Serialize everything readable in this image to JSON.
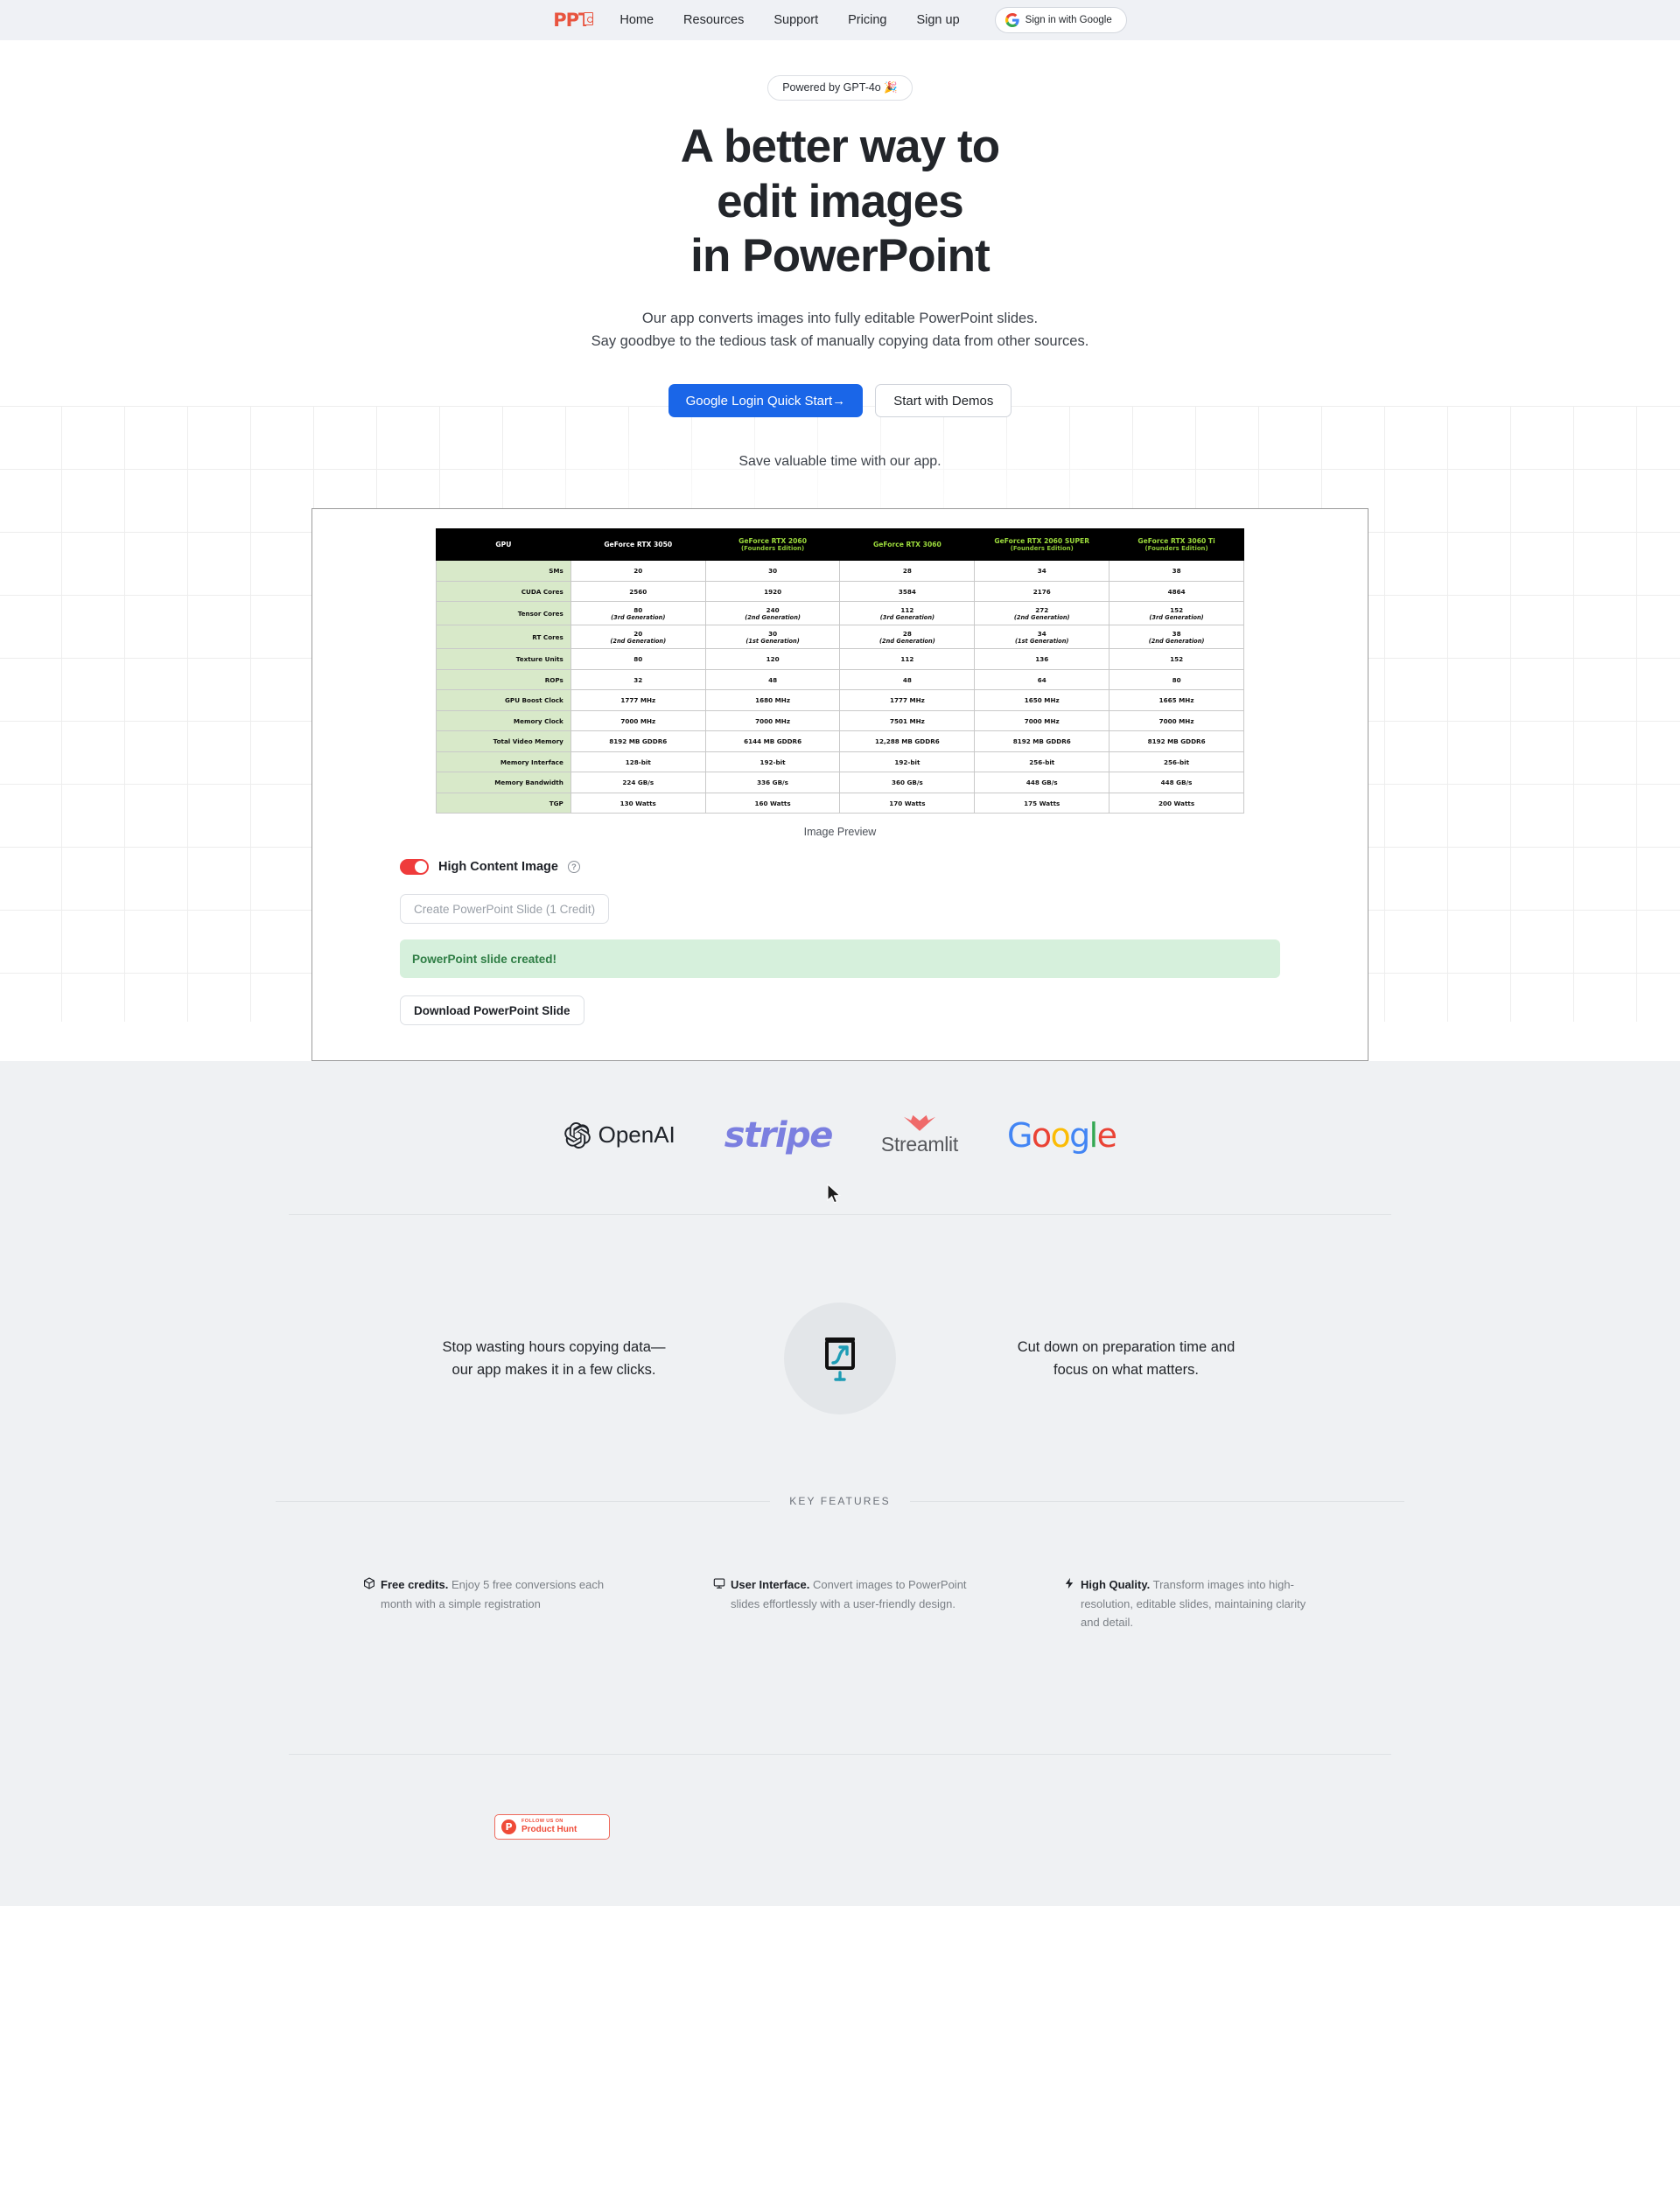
{
  "nav": {
    "logo": "PPT",
    "links": [
      "Home",
      "Resources",
      "Support",
      "Pricing",
      "Sign up"
    ],
    "google_button": "Sign in with Google"
  },
  "hero": {
    "pill": "Powered by GPT-4o 🎉",
    "title_lines": [
      "A better way to",
      "edit images",
      "in PowerPoint"
    ],
    "subtitle_lines": [
      "Our app converts images into fully editable PowerPoint slides.",
      "Say goodbye to the tedious task of manually copying data from other sources."
    ],
    "primary_cta": "Google Login Quick Start→",
    "secondary_cta": "Start with Demos",
    "tagline": "Save valuable time with our app."
  },
  "app": {
    "preview_label": "Image Preview",
    "toggle_label": "High Content Image",
    "toggle_on": true,
    "toggle_color": "#ef3b3b",
    "help_icon": "?",
    "create_button": "Create PowerPoint Slide (1 Credit)",
    "status_message": "PowerPoint slide created!",
    "status_color": "#2e7d44",
    "download_button": "Download PowerPoint Slide"
  },
  "chart_data": {
    "type": "table",
    "title": "GPU Comparison",
    "columns": [
      {
        "name": "GPU",
        "sub": "",
        "accent": false
      },
      {
        "name": "GeForce RTX 3050",
        "sub": "",
        "accent": false
      },
      {
        "name": "GeForce RTX 2060",
        "sub": "(Founders Edition)",
        "accent": true
      },
      {
        "name": "GeForce RTX 3060",
        "sub": "",
        "accent": true
      },
      {
        "name": "GeForce RTX 2060 SUPER",
        "sub": "(Founders Edition)",
        "accent": true
      },
      {
        "name": "GeForce RTX 3060 Ti",
        "sub": "(Founders Edition)",
        "accent": true
      }
    ],
    "rows": [
      {
        "label": "SMs",
        "values": [
          "20",
          "30",
          "28",
          "34",
          "38"
        ],
        "subs": [
          "",
          "",
          "",
          "",
          ""
        ]
      },
      {
        "label": "CUDA Cores",
        "values": [
          "2560",
          "1920",
          "3584",
          "2176",
          "4864"
        ],
        "subs": [
          "",
          "",
          "",
          "",
          ""
        ]
      },
      {
        "label": "Tensor Cores",
        "values": [
          "80",
          "240",
          "112",
          "272",
          "152"
        ],
        "subs": [
          "(3rd Generation)",
          "(2nd Generation)",
          "(3rd Generation)",
          "(2nd Generation)",
          "(3rd Generation)"
        ]
      },
      {
        "label": "RT Cores",
        "values": [
          "20",
          "30",
          "28",
          "34",
          "38"
        ],
        "subs": [
          "(2nd Generation)",
          "(1st Generation)",
          "(2nd Generation)",
          "(1st Generation)",
          "(2nd Generation)"
        ]
      },
      {
        "label": "Texture Units",
        "values": [
          "80",
          "120",
          "112",
          "136",
          "152"
        ],
        "subs": [
          "",
          "",
          "",
          "",
          ""
        ]
      },
      {
        "label": "ROPs",
        "values": [
          "32",
          "48",
          "48",
          "64",
          "80"
        ],
        "subs": [
          "",
          "",
          "",
          "",
          ""
        ]
      },
      {
        "label": "GPU Boost Clock",
        "values": [
          "1777 MHz",
          "1680 MHz",
          "1777 MHz",
          "1650 MHz",
          "1665 MHz"
        ],
        "subs": [
          "",
          "",
          "",
          "",
          ""
        ]
      },
      {
        "label": "Memory Clock",
        "values": [
          "7000 MHz",
          "7000 MHz",
          "7501 MHz",
          "7000 MHz",
          "7000 MHz"
        ],
        "subs": [
          "",
          "",
          "",
          "",
          ""
        ]
      },
      {
        "label": "Total Video Memory",
        "values": [
          "8192 MB GDDR6",
          "6144 MB GDDR6",
          "12,288 MB GDDR6",
          "8192 MB GDDR6",
          "8192 MB GDDR6"
        ],
        "subs": [
          "",
          "",
          "",
          "",
          ""
        ]
      },
      {
        "label": "Memory Interface",
        "values": [
          "128-bit",
          "192-bit",
          "192-bit",
          "256-bit",
          "256-bit"
        ],
        "subs": [
          "",
          "",
          "",
          "",
          ""
        ]
      },
      {
        "label": "Memory Bandwidth",
        "values": [
          "224 GB/s",
          "336 GB/s",
          "360 GB/s",
          "448 GB/s",
          "448 GB/s"
        ],
        "subs": [
          "",
          "",
          "",
          "",
          ""
        ]
      },
      {
        "label": "TGP",
        "values": [
          "130 Watts",
          "160 Watts",
          "170 Watts",
          "175 Watts",
          "200 Watts"
        ],
        "subs": [
          "",
          "",
          "",
          "",
          ""
        ]
      }
    ],
    "header_bg": "#000000",
    "header_accent_color": "#9cdb3c",
    "rowlabel_bg": "#d8e9c9"
  },
  "brands": [
    {
      "name": "OpenAI",
      "icon": "openai-icon"
    },
    {
      "name": "stripe",
      "icon": "stripe-wordmark"
    },
    {
      "name": "Streamlit",
      "icon": "streamlit-icon"
    },
    {
      "name": "Google",
      "icon": "google-wordmark"
    }
  ],
  "value_props": {
    "left_lines": [
      "Stop wasting hours copying data—",
      "our app makes it in a few clicks."
    ],
    "right_lines": [
      "Cut down on preparation time and",
      "focus on what matters."
    ],
    "icon": "presentation-board-icon",
    "icon_accent": "#1d9cb5"
  },
  "key_features": {
    "section_label": "KEY FEATURES",
    "items": [
      {
        "icon": "cube-icon",
        "title": "Free credits.",
        "body": "Enjoy 5 free conversions each month with a simple registration"
      },
      {
        "icon": "monitor-icon",
        "title": "User Interface.",
        "body": "Convert images to PowerPoint slides effortlessly with a user-friendly design."
      },
      {
        "icon": "bolt-icon",
        "title": "High Quality.",
        "body": "Transform images into high-resolution, editable slides, maintaining clarity and detail."
      }
    ]
  },
  "product_hunt": {
    "top_text": "FOLLOW US ON",
    "main_text": "Product Hunt",
    "mark": "P",
    "color": "#ef4b38"
  }
}
